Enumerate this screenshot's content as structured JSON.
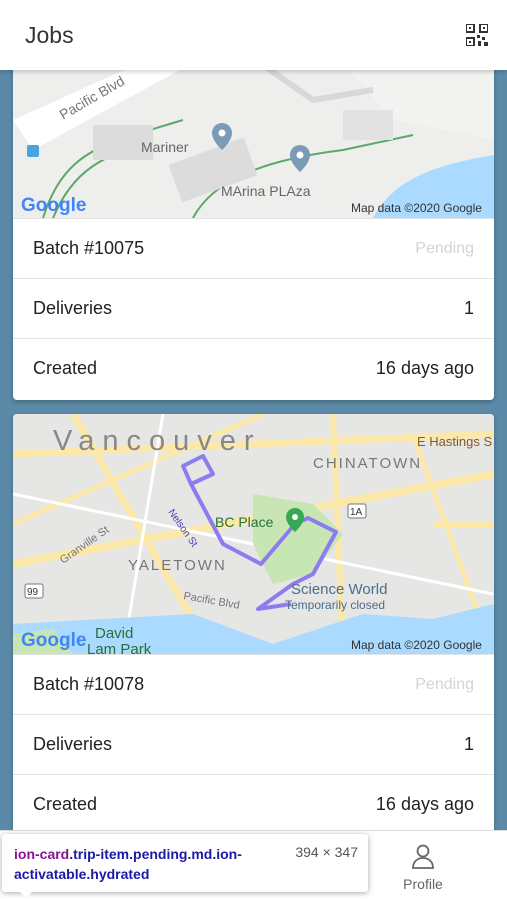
{
  "header": {
    "title": "Jobs",
    "qr_icon": "qr-code-icon"
  },
  "cards": [
    {
      "map": {
        "labels": {
          "street": "Pacific Blvd",
          "poi1": "Mariner",
          "poi2": "MArina PLAza",
          "google": "Google",
          "attribution": "Map data ©2020 Google"
        }
      },
      "batch": "Batch #10075",
      "status": "Pending",
      "deliveries_label": "Deliveries",
      "deliveries_value": "1",
      "created_label": "Created",
      "created_value": "16 days ago"
    },
    {
      "map": {
        "labels": {
          "city": "Vancouver",
          "hastings": "E Hastings S",
          "chinatown": "CHINATOWN",
          "bcplace": "BC Place",
          "granville": "Granville St",
          "nelson": "Nelson St",
          "yaletown": "YALETOWN",
          "hwy99": "99",
          "hwy1a": "1A",
          "pacific": "Pacific Blvd",
          "scienceworld": "Science World",
          "closed": "Temporarily closed",
          "park1": "David",
          "park2": "Lam Park",
          "google": "Google",
          "attribution": "Map data ©2020 Google"
        }
      },
      "batch": "Batch #10078",
      "status": "Pending",
      "deliveries_label": "Deliveries",
      "deliveries_value": "1",
      "created_label": "Created",
      "created_value": "16 days ago"
    }
  ],
  "tabbar": {
    "profile_label": "Profile",
    "profile_icon": "person-icon"
  },
  "inspector": {
    "tag": "ion-card",
    "classes": ".trip-item.pending.md.ion-activatable.hydrated",
    "dimensions": "394 × 347"
  },
  "colors": {
    "background": "#5b8aa8",
    "route": "#8c7cf0",
    "water": "#aadaff",
    "park": "#c8e6b4",
    "road": "#fce8a8"
  }
}
